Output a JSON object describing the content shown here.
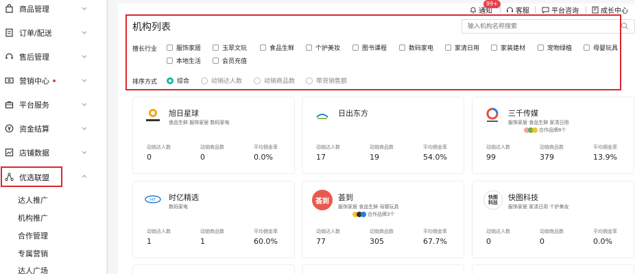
{
  "sidebar": {
    "items": [
      {
        "label": "商品管理",
        "icon": "bag-icon"
      },
      {
        "label": "订单/配送",
        "icon": "order-icon"
      },
      {
        "label": "售后管理",
        "icon": "service-icon"
      },
      {
        "label": "营销中心",
        "icon": "ticket-icon"
      },
      {
        "label": "平台服务",
        "icon": "briefcase-icon"
      },
      {
        "label": "资金结算",
        "icon": "yen-icon"
      },
      {
        "label": "店铺数据",
        "icon": "chart-icon"
      },
      {
        "label": "优选联盟",
        "icon": "network-icon"
      }
    ],
    "sub_items": [
      "达人推广",
      "机构推广",
      "合作管理",
      "专属营销",
      "达人广场"
    ]
  },
  "topbar": {
    "notify": "通知",
    "notify_badge": "99+",
    "service": "客服",
    "consult": "平台咨询",
    "growth": "成长中心"
  },
  "page": {
    "title": "机构列表",
    "search_placeholder": "输入机构名称搜索"
  },
  "filters": {
    "industry_label": "擅长行业",
    "industries": [
      "服饰家居",
      "玉翠文玩",
      "食品生鲜",
      "个护美妆",
      "图书课程",
      "数码家电",
      "家清日用",
      "家装建材",
      "宠物绿植",
      "母婴玩具",
      "本地生活",
      "会员充值"
    ],
    "sort_label": "排序方式",
    "sort_options": [
      "综合",
      "动销达人数",
      "动销商品数",
      "带货销售额"
    ],
    "sort_selected": "综合"
  },
  "stat_labels": {
    "talents": "动销达人数",
    "products": "动销商品数",
    "commission": "平均佣金率"
  },
  "agencies": [
    {
      "name": "旭日星球",
      "tags": "食品生鲜  服饰家居  数码家电",
      "brands": "",
      "talents": "0",
      "products": "0",
      "commission": "0.0%",
      "logo_color": "#f0a818"
    },
    {
      "name": "日出东方",
      "tags": "",
      "brands": "",
      "talents": "17",
      "products": "19",
      "commission": "54.0%",
      "logo_color": "#2a7fd4"
    },
    {
      "name": "三千传媒",
      "tags": "服饰家居  食品生鲜  家清日用",
      "brands": "合作品牌8个",
      "talents": "99",
      "products": "379",
      "commission": "13.9%",
      "logo_color": "#e64b3b"
    },
    {
      "name": "时亿精选",
      "tags": "数码家电",
      "brands": "",
      "talents": "1",
      "products": "1",
      "commission": "60.0%",
      "logo_color": "#2a7fd4"
    },
    {
      "name": "荟到",
      "tags": "服饰家居  食品生鲜  母婴玩具",
      "brands": "合作品牌3个",
      "talents": "77",
      "products": "305",
      "commission": "67.7%",
      "logo_color": "#e85a4f",
      "logo_text": "荟到"
    },
    {
      "name": "快图科技",
      "tags": "服饰家居  家清日用  个护美妆",
      "brands": "",
      "talents": "0",
      "products": "0",
      "commission": "0.0%",
      "logo_color": "#333333",
      "logo_text": "快图科技"
    }
  ],
  "colors": {
    "accent": "#14b8a6",
    "highlight": "#d9262c",
    "badge": "#e8414b"
  }
}
